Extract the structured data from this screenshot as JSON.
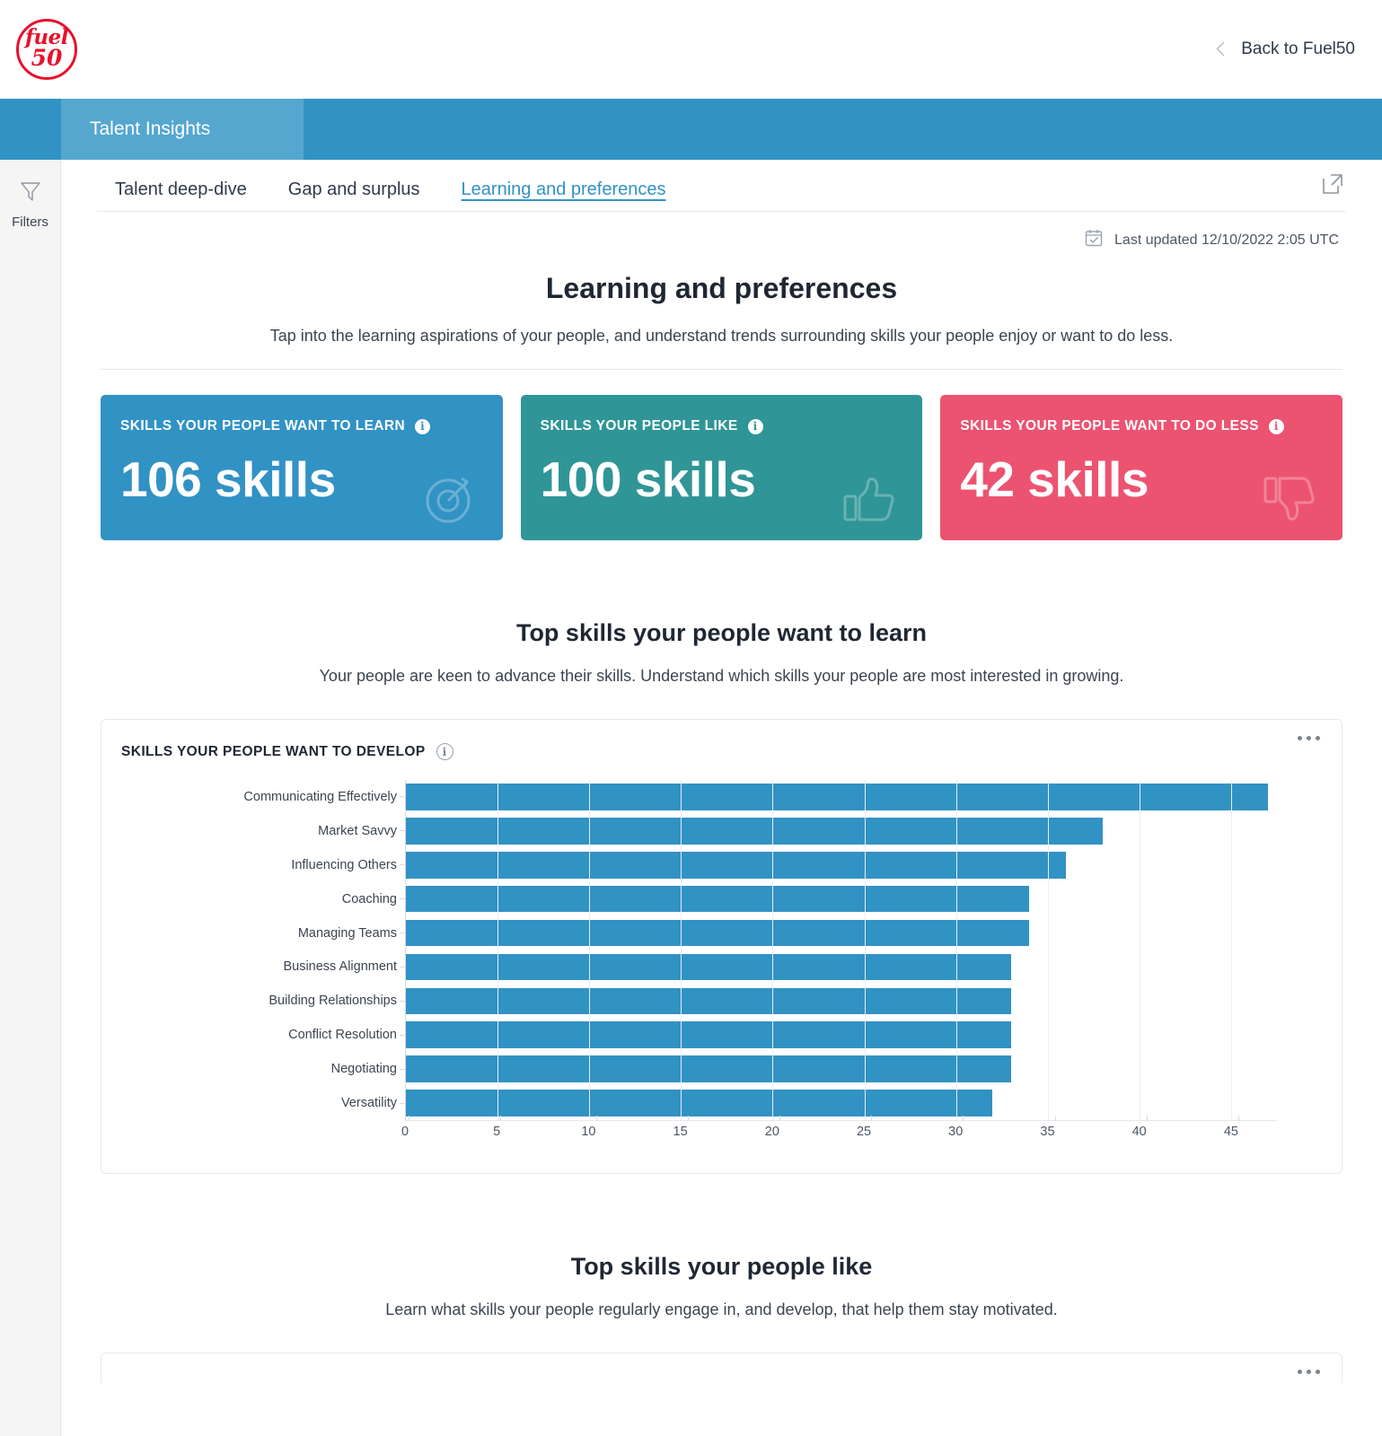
{
  "topbar": {
    "logo_line1": "fuel",
    "logo_line2": "50",
    "back_label": "Back to Fuel50"
  },
  "appbar": {
    "active_tab": "Talent Insights"
  },
  "rail": {
    "filters_label": "Filters",
    "filters_icon": "funnel-icon"
  },
  "subtabs": {
    "items": [
      {
        "label": "Talent deep-dive",
        "active": false
      },
      {
        "label": "Gap and surplus",
        "active": false
      },
      {
        "label": "Learning and preferences",
        "active": true
      }
    ],
    "popout_icon": "external-link-icon"
  },
  "meta": {
    "last_updated": "Last updated 12/10/2022 2:05 UTC",
    "calendar_icon": "calendar-check-icon"
  },
  "page": {
    "title": "Learning and preferences",
    "subtitle": "Tap into the learning aspirations of your people, and understand trends surrounding skills your people enjoy or want to do less."
  },
  "kpis": [
    {
      "label": "SKILLS YOUR PEOPLE WANT TO LEARN",
      "value": "106 skills",
      "color": "#3192c4",
      "icon": "target-icon",
      "info": "i"
    },
    {
      "label": "SKILLS YOUR PEOPLE LIKE",
      "value": "100 skills",
      "color": "#2f9596",
      "icon": "thumbs-up-icon",
      "info": "i"
    },
    {
      "label": "SKILLS YOUR PEOPLE WANT TO DO LESS",
      "value": "42 skills",
      "color": "#ec5371",
      "icon": "thumbs-down-icon",
      "info": "i"
    }
  ],
  "sections": [
    {
      "title": "Top skills your people want to learn",
      "subtitle": "Your people are keen to advance their skills. Understand which skills your people are most interested in growing."
    },
    {
      "title": "Top skills your people like",
      "subtitle": "Learn what skills your people regularly engage in, and develop, that help them stay motivated."
    }
  ],
  "chart_card": {
    "kicker": "SKILLS YOUR PEOPLE WANT TO DEVELOP",
    "info": "i",
    "menu_icon": "kebab-menu-icon"
  },
  "chart_data": {
    "type": "bar",
    "orientation": "horizontal",
    "title": "SKILLS YOUR PEOPLE WANT TO DEVELOP",
    "xlabel": "",
    "ylabel": "",
    "xlim": [
      0,
      47.5
    ],
    "xticks": [
      0,
      5,
      10,
      15,
      20,
      25,
      30,
      35,
      40,
      45
    ],
    "grid": true,
    "legend": "none",
    "bar_color": "#3192c4",
    "categories": [
      "Communicating Effectively",
      "Market Savvy",
      "Influencing Others",
      "Coaching",
      "Managing Teams",
      "Business Alignment",
      "Building Relationships",
      "Conflict Resolution",
      "Negotiating",
      "Versatility"
    ],
    "values": [
      47,
      38,
      36,
      34,
      34,
      33,
      33,
      33,
      33,
      32
    ]
  }
}
